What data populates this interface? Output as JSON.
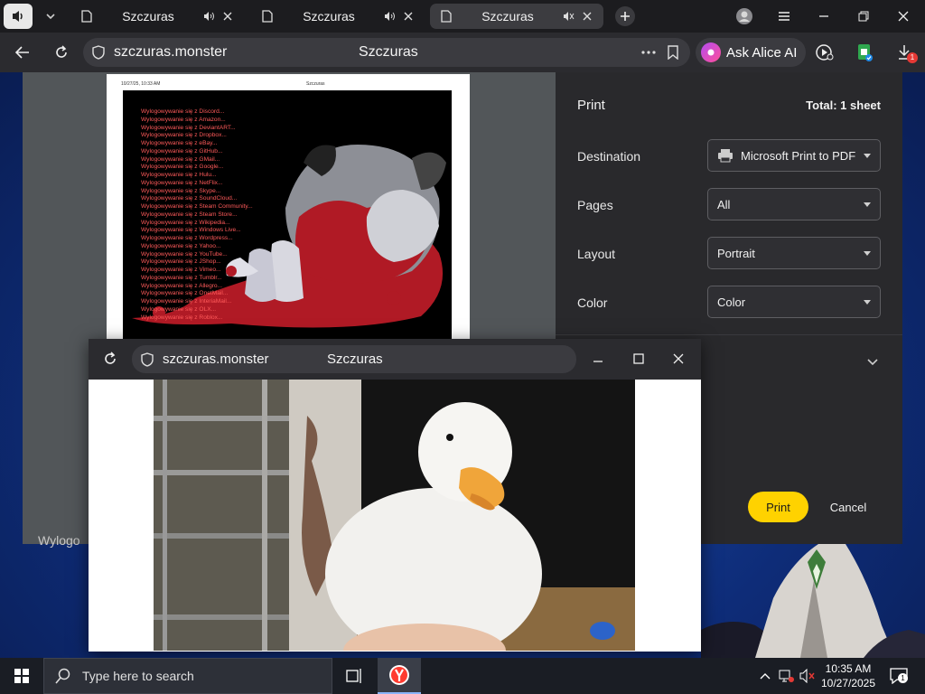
{
  "browser": {
    "tabs": [
      {
        "title": "Szczuras",
        "active": false
      },
      {
        "title": "Szczuras",
        "active": false
      },
      {
        "title": "Szczuras",
        "active": true
      }
    ],
    "address": {
      "host": "szczuras.monster",
      "page_title": "Szczuras"
    },
    "alice_label": "Ask Alice AI",
    "downloads_badge": "1"
  },
  "print_preview": {
    "sheet_header": {
      "date": "10/27/25, 10:33 AM",
      "title": "Szczuras"
    },
    "logout_messages": [
      "Wylogowywanie się z Discord...",
      "Wylogowywanie się z Amazon...",
      "Wylogowywanie się z DeviantART...",
      "Wylogowywanie się z Dropbox...",
      "Wylogowywanie się z eBay...",
      "Wylogowywanie się z GitHub...",
      "Wylogowywanie się z GMail...",
      "Wylogowywanie się z Google...",
      "Wylogowywanie się z Hulu...",
      "Wylogowywanie się z NetFlix...",
      "Wylogowywanie się z Skype...",
      "Wylogowywanie się z SoundCloud...",
      "Wylogowywanie się z Steam Community...",
      "Wylogowywanie się z Steam Store...",
      "Wylogowywanie się z Wikipedia...",
      "Wylogowywanie się z Windows Live...",
      "Wylogowywanie się z Wordpress...",
      "Wylogowywanie się z Yahoo...",
      "Wylogowywanie się z YouTube...",
      "Wylogowywanie się z JShop...",
      "Wylogowywanie się z Vimeo...",
      "Wylogowywanie się z Tumblr...",
      "Wylogowywanie się z Allegro...",
      "Wylogowywanie się z OnetMail...",
      "Wylogowywanie się z InteriaMail...",
      "Wylogowywanie się z OLX...",
      "Wylogowywanie się z Roblox..."
    ]
  },
  "print_panel": {
    "title": "Print",
    "total": "Total: 1 sheet",
    "settings": {
      "destination": {
        "label": "Destination",
        "value": "Microsoft Print to PDF"
      },
      "pages": {
        "label": "Pages",
        "value": "All"
      },
      "layout": {
        "label": "Layout",
        "value": "Portrait"
      },
      "color": {
        "label": "Color",
        "value": "Color"
      }
    },
    "print_button": "Print",
    "cancel_button": "Cancel"
  },
  "background_fragment": "Wylogo",
  "popup": {
    "host": "szczuras.monster",
    "page_title": "Szczuras"
  },
  "taskbar": {
    "search_placeholder": "Type here to search",
    "time": "10:35 AM",
    "date": "10/27/2025",
    "notification_count": "1"
  },
  "colors": {
    "accent_yellow": "#ffd200",
    "panel_bg": "#29292c",
    "logout_text": "#ff5a5a"
  }
}
